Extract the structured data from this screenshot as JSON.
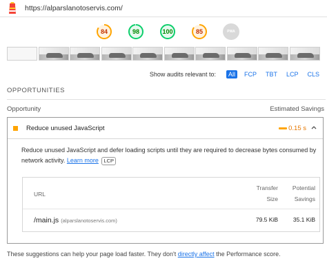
{
  "header": {
    "url": "https://alparslanotoservis.com/"
  },
  "scores": [
    {
      "value": "84",
      "fraction": 0.84,
      "color": "#ffa400",
      "bg": "#fff3e0"
    },
    {
      "value": "98",
      "fraction": 0.98,
      "color": "#0cce6b",
      "bg": "#e6f9ef"
    },
    {
      "value": "100",
      "fraction": 1.0,
      "color": "#0cce6b",
      "bg": "#e6f9ef"
    },
    {
      "value": "85",
      "fraction": 0.85,
      "color": "#ffa400",
      "bg": "#fff3e0"
    },
    {
      "value": "PWA",
      "fraction": 0,
      "color": "#d9d9d9",
      "bg": "#d9d9d9"
    }
  ],
  "filters": {
    "label": "Show audits relevant to:",
    "options": [
      "All",
      "FCP",
      "TBT",
      "LCP",
      "CLS"
    ],
    "active": "All"
  },
  "opportunities": {
    "title": "OPPORTUNITIES",
    "col_left": "Opportunity",
    "col_right": "Estimated Savings",
    "audit": {
      "title": "Reduce unused JavaScript",
      "savings": "0.15 s",
      "description": "Reduce unused JavaScript and defer loading scripts until they are required to decrease bytes consumed by network activity.",
      "learn_more": "Learn more",
      "tag": "LCP",
      "table": {
        "headers": {
          "url": "URL",
          "transfer_size": "Transfer\nSize",
          "potential_savings": "Potential\nSavings"
        },
        "rows": [
          {
            "url": "/main.js",
            "host": "(alparslanotoservis.com)",
            "transfer_size": "79.5 KiB",
            "potential_savings": "35.1 KiB"
          }
        ]
      }
    }
  },
  "footer": {
    "prefix": "These suggestions can help your page load faster. They don't ",
    "link": "directly affect",
    "suffix": " the Performance score."
  },
  "colors": {
    "accent": "#1a73e8",
    "warn": "#ffa400",
    "pass": "#0cce6b"
  },
  "icons": [
    "lighthouse-icon",
    "chevron-up-icon"
  ]
}
